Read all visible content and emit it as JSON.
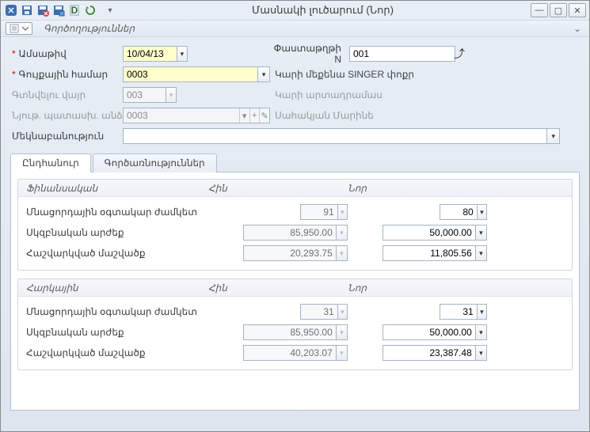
{
  "window": {
    "title": "Մասնակի լուծարում (Նոր)"
  },
  "subbar": {
    "label": "Գործողություններ"
  },
  "form": {
    "date": {
      "label": "Ամսաթիվ",
      "value": "10/04/13"
    },
    "docnum": {
      "label": "Փաստաթղթի N",
      "value": "001"
    },
    "asset": {
      "label": "Գույքային համար",
      "value": "0003",
      "descr": "Կարի մեքենա SINGER փոքր"
    },
    "location": {
      "label": "Գտնվելու վայր",
      "value": "003",
      "descr": "Կարի արտադրամաս"
    },
    "responsible": {
      "label": "Նյութ. պատասխ. անձ",
      "value": "0003",
      "descr": "Սահակյան Մարինե"
    },
    "comment": {
      "label": "Մեկնաբանություն",
      "value": ""
    }
  },
  "tabs": {
    "general": "Ընդհանուր",
    "operations": "Գործառնություններ"
  },
  "groups": {
    "financial": {
      "title": "Ֆինանսական",
      "colOld": "Հին",
      "colNew": "Նոր",
      "rows": {
        "remLife": {
          "label": "Մնացորդային օգտակար ժամկետ",
          "old": "91",
          "new": "80"
        },
        "initVal": {
          "label": "Սկզբնական արժեք",
          "old": "85,950.00",
          "new": "50,000.00"
        },
        "accDepr": {
          "label": "Հաշվարկված մաշվածք",
          "old": "20,293.75",
          "new": "11,805.56"
        }
      }
    },
    "tax": {
      "title": "Հարկային",
      "colOld": "Հին",
      "colNew": "Նոր",
      "rows": {
        "remLife": {
          "label": "Մնացորդային օգտակար ժամկետ",
          "old": "31",
          "new": "31"
        },
        "initVal": {
          "label": "Սկզբնական արժեք",
          "old": "85,950.00",
          "new": "50,000.00"
        },
        "accDepr": {
          "label": "Հաշվարկված մաշվածք",
          "old": "40,203.07",
          "new": "23,387.48"
        }
      }
    }
  }
}
